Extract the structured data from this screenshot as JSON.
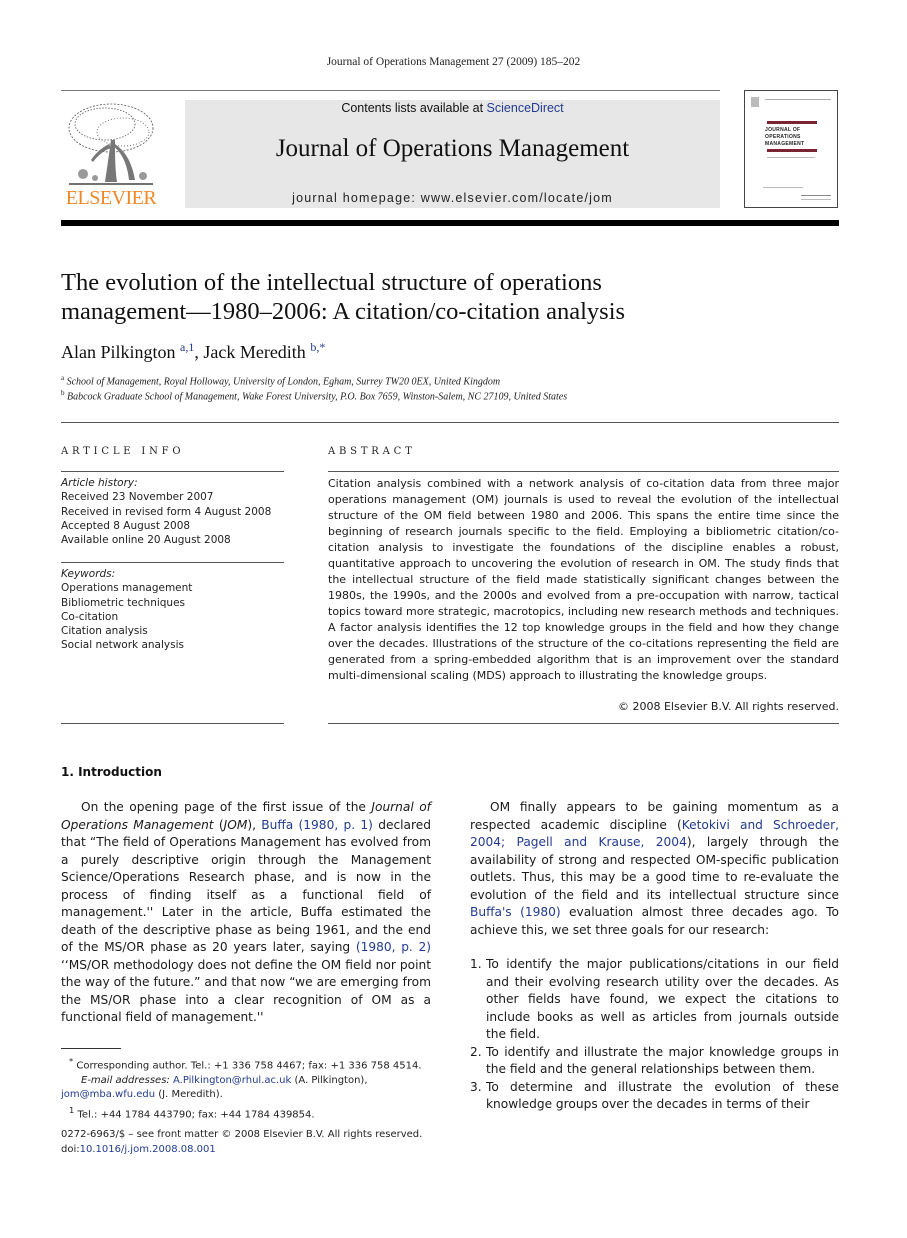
{
  "running_head": "Journal of Operations Management 27 (2009) 185–202",
  "masthead": {
    "publisher_logo_text": "ELSEVIER",
    "contents_prefix": "Contents lists available at ",
    "contents_link": "ScienceDirect",
    "journal_name": "Journal of Operations Management",
    "homepage": "journal homepage: www.elsevier.com/locate/jom",
    "cover_title_lines": [
      "JOURNAL OF",
      "OPERATIONS",
      "MANAGEMENT"
    ]
  },
  "article": {
    "title_line1": "The evolution of the intellectual structure of operations",
    "title_line2": "management—1980–2006: A citation/co-citation analysis",
    "authors": [
      {
        "name": "Alan Pilkington",
        "marks": "a,1"
      },
      {
        "name": "Jack Meredith",
        "marks": "b,*"
      }
    ],
    "author_separator": ", ",
    "affiliations": [
      {
        "mark": "a",
        "text": "School of Management, Royal Holloway, University of London, Egham, Surrey TW20 0EX, United Kingdom"
      },
      {
        "mark": "b",
        "text": "Babcock Graduate School of Management, Wake Forest University, P.O. Box 7659, Winston-Salem, NC 27109, United States"
      }
    ]
  },
  "article_info": {
    "heading": "ARTICLE INFO",
    "history_label": "Article history:",
    "history": [
      "Received 23 November 2007",
      "Received in revised form 4 August 2008",
      "Accepted 8 August 2008",
      "Available online 20 August 2008"
    ],
    "keywords_label": "Keywords:",
    "keywords": [
      "Operations management",
      "Bibliometric techniques",
      "Co-citation",
      "Citation analysis",
      "Social network analysis"
    ]
  },
  "abstract": {
    "heading": "ABSTRACT",
    "text": "Citation analysis combined with a network analysis of co-citation data from three major operations management (OM) journals is used to reveal the evolution of the intellectual structure of the OM field between 1980 and 2006. This spans the entire time since the beginning of research journals specific to the field. Employing a bibliometric citation/co-citation analysis to investigate the foundations of the discipline enables a robust, quantitative approach to uncovering the evolution of research in OM. The study finds that the intellectual structure of the field made statistically significant changes between the 1980s, the 1990s, and the 2000s and evolved from a pre-occupation with narrow, tactical topics toward more strategic, macrotopics, including new research methods and techniques. A factor analysis identifies the 12 top knowledge groups in the field and how they change over the decades. Illustrations of the structure of the co-citations representing the field are generated from a spring-embedded algorithm that is an improvement over the standard multi-dimensional scaling (MDS) approach to illustrating the knowledge groups.",
    "copyright": "© 2008 Elsevier B.V. All rights reserved."
  },
  "introduction": {
    "heading": "1.  Introduction",
    "p1_a": "On the opening page of the first issue of the ",
    "p1_journal_italic": "Journal of Operations Management",
    "p1_b": " (",
    "p1_jom_italic": "JOM",
    "p1_c": "), ",
    "p1_cite1": "Buffa (1980, p. 1)",
    "p1_d": " declared that “The field of Operations Management has evolved from a purely descriptive origin through the Management Science/Operations Research phase, and is now in the process of finding itself as a functional field of management.'' Later in the article, Buffa estimated the death of the descriptive phase as being 1961, and the end of the MS/OR phase as 20 years later, saying ",
    "p1_cite2": "(1980, p. 2)",
    "p1_e": " ‘‘MS/OR methodology does not define the OM field nor point the way of the future.” and that now “we are emerging from the MS/OR phase into a clear recognition of OM as a functional field of management.''",
    "p2_a": "OM finally appears to be gaining momentum as a respected academic discipline (",
    "p2_cite1": "Ketokivi and Schroeder, 2004; Pagell and Krause, 2004",
    "p2_b": "), largely through the availability of strong and respected OM-specific publication outlets. Thus, this may be a good time to re-evaluate the evolution of the field and its intellectual structure since ",
    "p2_cite2": "Buffa's (1980)",
    "p2_c": " evaluation almost three decades ago. To achieve this, we set three goals for our research:",
    "goals": [
      {
        "num": "1.",
        "text": "To identify the major publications/citations in our field and their evolving research utility over the decades. As other fields have found, we expect the citations to include books as well as articles from journals outside the field."
      },
      {
        "num": "2.",
        "text": "To identify and illustrate the major knowledge groups in the field and the general relationships between them."
      },
      {
        "num": "3.",
        "text": "To determine and illustrate the evolution of these knowledge groups over the decades in terms of their"
      }
    ]
  },
  "footnotes": {
    "corresponding_mark": "*",
    "corresponding": "Corresponding author. Tel.: +1 336 758 4467; fax: +1 336 758 4514.",
    "email_label": "E-mail addresses:",
    "email1": "A.Pilkington@rhul.ac.uk",
    "email1_owner": " (A. Pilkington),",
    "email2": "jom@mba.wfu.edu",
    "email2_owner": " (J. Meredith).",
    "note1_mark": "1",
    "note1": "Tel.: +44 1784 443790; fax: +44 1784 439854.",
    "front_matter": "0272-6963/$ – see front matter © 2008 Elsevier B.V. All rights reserved.",
    "doi_prefix": "doi:",
    "doi": "10.1016/j.jom.2008.08.001"
  },
  "colors": {
    "link": "#223b8f",
    "elsevier_orange": "#f0882a",
    "banner_gray": "#e7e7e7"
  }
}
